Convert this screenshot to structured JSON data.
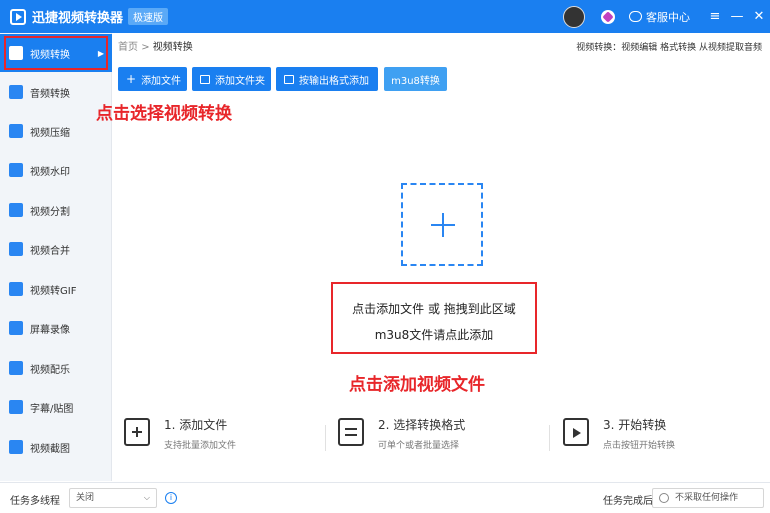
{
  "titlebar": {
    "app_title": "迅捷视频转换器",
    "edition_badge": "极速版",
    "service_label": "客服中心",
    "controls": [
      "≡",
      "—",
      "✕"
    ]
  },
  "sidebar": {
    "items": [
      {
        "label": "视频转换",
        "icon": "video-convert-icon",
        "active": true
      },
      {
        "label": "音频转换",
        "icon": "audio-convert-icon"
      },
      {
        "label": "视频压缩",
        "icon": "compress-icon"
      },
      {
        "label": "视频水印",
        "icon": "watermark-icon"
      },
      {
        "label": "视频分割",
        "icon": "split-icon"
      },
      {
        "label": "视频合并",
        "icon": "merge-icon"
      },
      {
        "label": "视频转GIF",
        "icon": "gif-icon"
      },
      {
        "label": "屏幕录像",
        "icon": "screen-record-icon"
      },
      {
        "label": "视频配乐",
        "icon": "music-icon"
      },
      {
        "label": "字幕/贴图",
        "icon": "subtitle-icon"
      },
      {
        "label": "视频截图",
        "icon": "screenshot-icon"
      }
    ]
  },
  "breadcrumb": {
    "home": "首页",
    "sep": ">",
    "current": "视频转换"
  },
  "top_links": "视频转换：视频编辑 格式转换 从视频提取音频",
  "toolbar": {
    "add_file": "添加文件",
    "add_folder": "添加文件夹",
    "add_by_format": "按输出格式添加",
    "m3u8": "m3u8转换"
  },
  "drop_zone": {
    "hint_line1": "点击添加文件 或 拖拽到此区域",
    "hint_line2": "m3u8文件请点此添加"
  },
  "annotations": {
    "select_convert": "点击选择视频转换",
    "add_video": "点击添加视频文件"
  },
  "steps": [
    {
      "title": "1. 添加文件",
      "desc": "支持批量添加文件",
      "icon": "add-file-step-icon"
    },
    {
      "title": "2. 选择转换格式",
      "desc": "可单个或者批量选择",
      "icon": "format-step-icon"
    },
    {
      "title": "3. 开始转换",
      "desc": "点击按钮开始转换",
      "icon": "convert-step-icon"
    }
  ],
  "statusbar": {
    "multithread_label": "任务多线程",
    "multithread_value": "关闭",
    "on_complete_label": "任务完成后",
    "on_complete_value": "不采取任何操作"
  },
  "colors": {
    "brand": "#1a7ff0",
    "annotation": "#e8262a"
  }
}
